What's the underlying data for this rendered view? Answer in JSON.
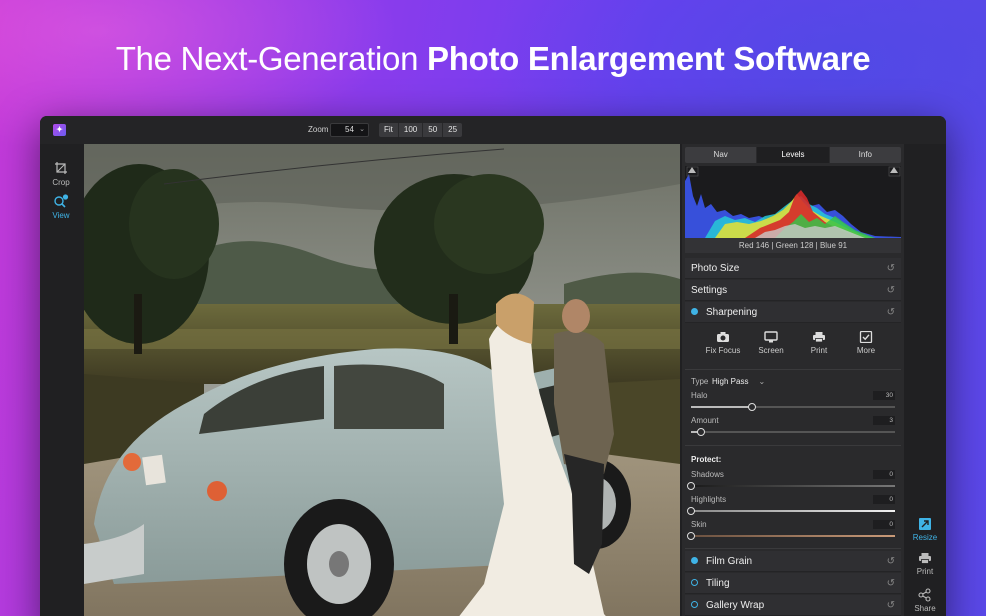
{
  "headline": {
    "light": "The Next-Generation ",
    "bold": "Photo Enlargement Software"
  },
  "titlebar": {
    "zoom_label": "Zoom",
    "zoom_value": "54",
    "zoom_presets": [
      "Fit",
      "100",
      "50",
      "25"
    ]
  },
  "left_tools": [
    {
      "label": "Crop",
      "icon": "crop-icon",
      "active": false
    },
    {
      "label": "View",
      "icon": "magnifier-icon",
      "active": true
    }
  ],
  "panel": {
    "tabs": [
      "Nav",
      "Levels",
      "Info"
    ],
    "active_tab": "Levels",
    "rgb_readout": "Red 146 | Green 128 | Blue  91",
    "sections": {
      "photo_size": "Photo Size",
      "settings": "Settings",
      "sharpening": "Sharpening",
      "film_grain": "Film Grain",
      "tiling": "Tiling",
      "gallery_wrap": "Gallery Wrap"
    },
    "presets": [
      {
        "label": "Fix Focus",
        "icon": "camera-icon"
      },
      {
        "label": "Screen",
        "icon": "monitor-icon"
      },
      {
        "label": "Print",
        "icon": "printer-icon"
      },
      {
        "label": "More",
        "icon": "checkbox-icon"
      }
    ],
    "type": {
      "label": "Type",
      "value": "High Pass"
    },
    "sliders": {
      "halo": {
        "label": "Halo",
        "value": "30",
        "fraction": 0.3
      },
      "amount": {
        "label": "Amount",
        "value": "3",
        "fraction": 0.05
      },
      "shadows": {
        "label": "Shadows",
        "value": "0",
        "fraction": 0.0
      },
      "highlights": {
        "label": "Highlights",
        "value": "0",
        "fraction": 0.0
      },
      "skin": {
        "label": "Skin",
        "value": "0",
        "fraction": 0.0
      }
    },
    "protect_label": "Protect:"
  },
  "right_tools": [
    {
      "label": "Resize",
      "icon": "resize-icon",
      "active": true
    },
    {
      "label": "Print",
      "icon": "printer-icon",
      "active": false
    },
    {
      "label": "Share",
      "icon": "share-icon",
      "active": false
    }
  ],
  "colors": {
    "accent": "#3fb3e6",
    "panel": "#2a2a2c",
    "window": "#202022"
  }
}
